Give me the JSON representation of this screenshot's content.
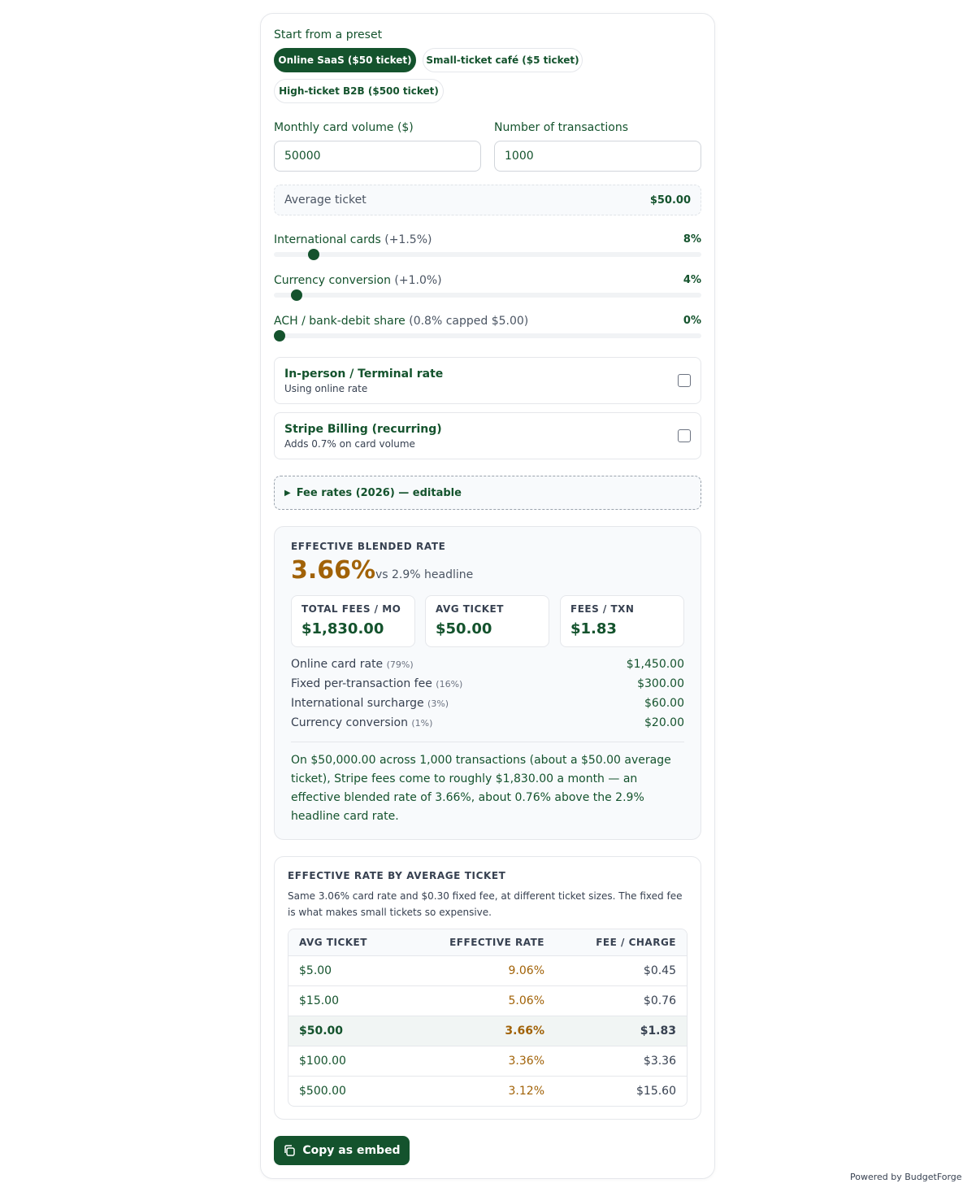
{
  "presets": {
    "title": "Start from a preset",
    "items": [
      "Online SaaS ($50 ticket)",
      "Small-ticket café ($5 ticket)",
      "High-ticket B2B ($500 ticket)"
    ]
  },
  "inputs": {
    "volume_label": "Monthly card volume ($)",
    "volume_value": "50000",
    "txn_label": "Number of transactions",
    "txn_value": "1000"
  },
  "average_ticket": {
    "label": "Average ticket",
    "value": "$50.00"
  },
  "sliders": [
    {
      "label": "International cards",
      "note": " (+1.5%)",
      "value_text": "8%",
      "value": 8
    },
    {
      "label": "Currency conversion",
      "note": " (+1.0%)",
      "value_text": "4%",
      "value": 4
    },
    {
      "label": "ACH / bank-debit share",
      "note": " (0.8% capped $5.00)",
      "value_text": "0%",
      "value": 0
    }
  ],
  "toggles": [
    {
      "title": "In-person / Terminal rate",
      "subtitle": "Using online rate",
      "checked": false
    },
    {
      "title": "Stripe Billing (recurring)",
      "subtitle": "Adds 0.7% on card volume",
      "checked": false
    }
  ],
  "fee_rates": {
    "label": "Fee rates (2026) — editable"
  },
  "summary": {
    "heading": "EFFECTIVE BLENDED RATE",
    "rate": "3.66%",
    "vs": "vs 2.9% headline",
    "stats": [
      {
        "label": "TOTAL FEES / MO",
        "value": "$1,830.00"
      },
      {
        "label": "AVG TICKET",
        "value": "$50.00"
      },
      {
        "label": "FEES / TXN",
        "value": "$1.83"
      }
    ],
    "breakdown": [
      {
        "label": "Online card rate",
        "pct": "(79%)",
        "amount": "$1,450.00"
      },
      {
        "label": "Fixed per-transaction fee",
        "pct": "(16%)",
        "amount": "$300.00"
      },
      {
        "label": "International surcharge",
        "pct": "(3%)",
        "amount": "$60.00"
      },
      {
        "label": "Currency conversion",
        "pct": "(1%)",
        "amount": "$20.00"
      }
    ],
    "narrative": "On $50,000.00 across 1,000 transactions (about a $50.00 average ticket), Stripe fees come to roughly $1,830.00 a month — an effective blended rate of 3.66%, about 0.76% above the 2.9% headline card rate."
  },
  "ticket_table": {
    "heading": "EFFECTIVE RATE BY AVERAGE TICKET",
    "description": "Same 3.06% card rate and $0.30 fixed fee, at different ticket sizes. The fixed fee is what makes small tickets so expensive.",
    "columns": [
      "AVG TICKET",
      "EFFECTIVE RATE",
      "FEE / CHARGE"
    ],
    "rows": [
      [
        "$5.00",
        "9.06%",
        "$0.45"
      ],
      [
        "$15.00",
        "5.06%",
        "$0.76"
      ],
      [
        "$50.00",
        "3.66%",
        "$1.83"
      ],
      [
        "$100.00",
        "3.36%",
        "$3.36"
      ],
      [
        "$500.00",
        "3.12%",
        "$15.60"
      ]
    ]
  },
  "copy_button": "Copy as embed",
  "powered_by": "Powered by BudgetForge",
  "colors": {
    "brand": "#14532d",
    "rate_accent": "#a16207"
  },
  "icons": {
    "copy": "copy-icon",
    "disclosure": "triangle-right-icon"
  }
}
